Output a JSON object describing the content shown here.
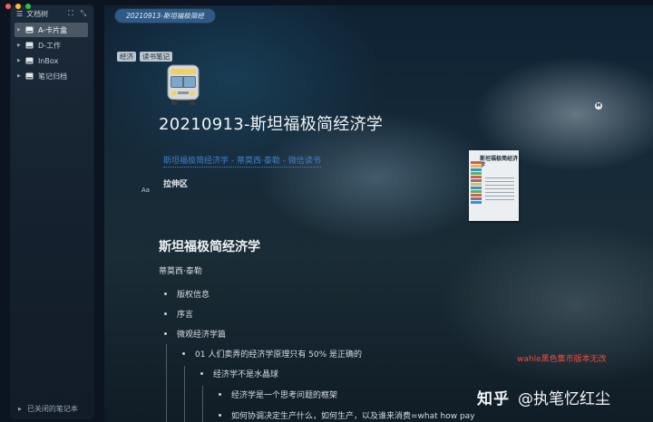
{
  "window": {
    "dot_colors": [
      "#ff5f57",
      "#febc2e",
      "#28c840"
    ]
  },
  "sidebar": {
    "header_title": "文档树",
    "tool_icons": [
      "list-icon",
      "expand-icon",
      "collapse-icon"
    ],
    "notebooks": [
      {
        "label": "A-卡片盒",
        "active": true
      },
      {
        "label": "D-工作",
        "active": false
      },
      {
        "label": "InBox",
        "active": false
      },
      {
        "label": "笔记归档",
        "active": false
      }
    ],
    "footer": "已关闭的笔记本"
  },
  "document": {
    "tab_title": "20210913-斯坦福极简经",
    "tags": [
      "经济",
      "读书笔记"
    ],
    "title": "20210913-斯坦福极简经济学",
    "reference_link": "斯坦福极简经济学 - 蒂莫西·泰勒 - 微信读书",
    "subheading": "拉伸区",
    "aa_label": "Aa",
    "m_badge": "M",
    "book_cover_title": "斯坦福极简经济学",
    "section_heading": "斯坦福极简经济学",
    "author": "蒂莫西·泰勒",
    "outline": [
      "版权信息",
      "序言",
      "微观经济学篇",
      "01 人们卖弄的经济学原理只有 50% 是正确的",
      "经济学不是水晶球",
      "经济学是一个思考问题的框架",
      "如何协调决定生产什么，如何生产，以及谁来消费=what how pay"
    ]
  },
  "watermarks": {
    "red_note": "wahle黑色集市版本无改",
    "zhihu_logo": "知乎",
    "zhihu_user": "@执笔忆红尘"
  },
  "colors": {
    "sidebar_active": "#4a5866",
    "link": "#3f7fcf",
    "tab": "#2d5a86",
    "red_note": "#ef4c3c"
  }
}
